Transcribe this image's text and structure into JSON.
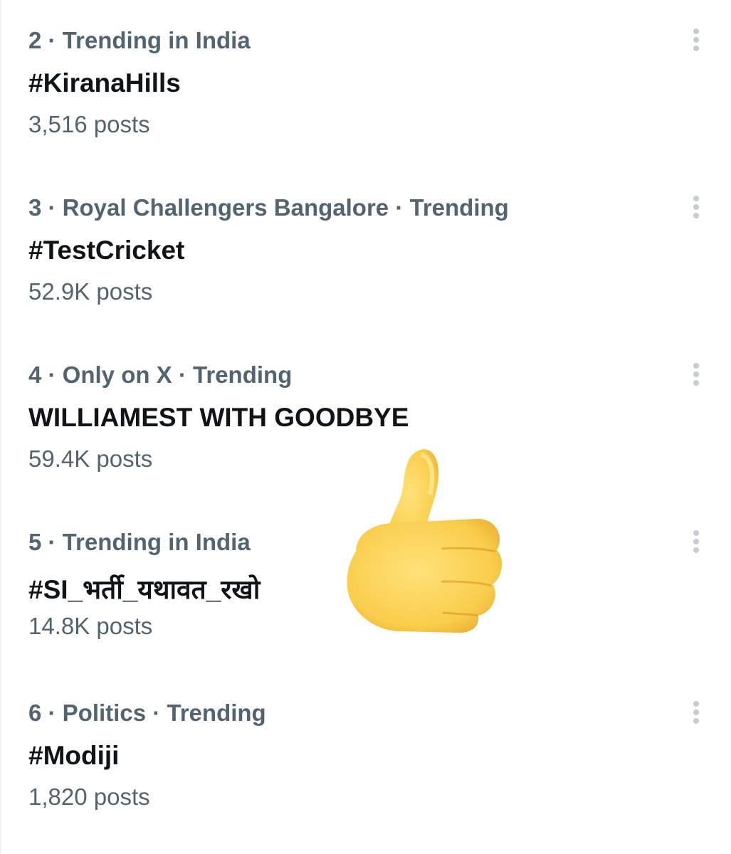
{
  "trends": [
    {
      "meta": "2 · Trending in India",
      "title": "#KiranaHills",
      "count": "3,516 posts"
    },
    {
      "meta": "3 · Royal Challengers Bangalore · Trending",
      "title": "#TestCricket",
      "count": "52.9K posts"
    },
    {
      "meta": "4 · Only on X · Trending",
      "title": "WILLIAMEST WITH GOODBYE",
      "count": "59.4K posts"
    },
    {
      "meta": "5 · Trending in India",
      "title": "#SI_भर्ती_यथावत_रखो",
      "count": "14.8K posts"
    },
    {
      "meta": "6 · Politics · Trending",
      "title": "#Modiji",
      "count": "1,820 posts"
    }
  ],
  "icons": {
    "more": "more-vertical-icon",
    "emoji": "thumbs-up-icon"
  },
  "colors": {
    "primary_text": "#0f1419",
    "secondary_text": "#536471",
    "icon_gray": "#c4cdd3",
    "emoji_fill": "#ffd256"
  }
}
